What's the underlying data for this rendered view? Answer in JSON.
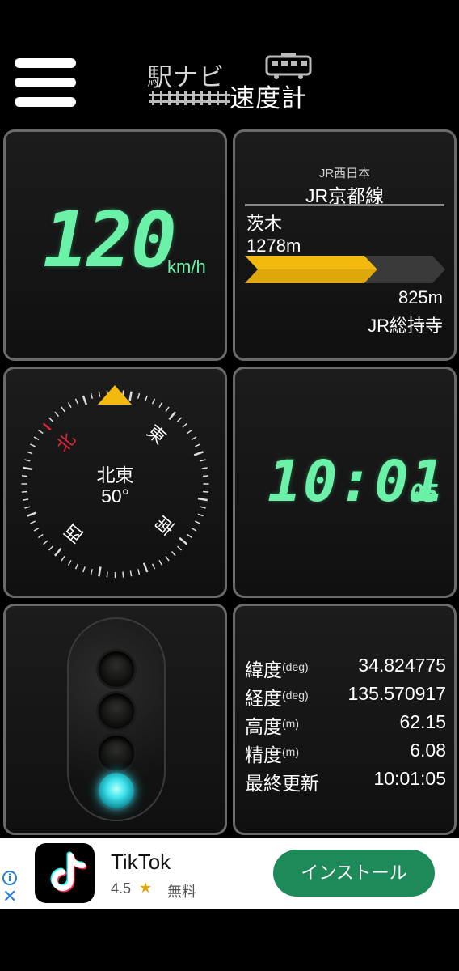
{
  "header": {
    "logo_top": "駅ナビ",
    "logo_bottom": "速度計",
    "menu_icon": "hamburger-menu-icon"
  },
  "speed": {
    "value": "120",
    "unit": "km/h"
  },
  "line": {
    "company": "JR西日本",
    "name": "JR京都線",
    "prev_station": "茨木",
    "prev_distance": "1278m",
    "next_distance": "825m",
    "next_station": "JR総持寺",
    "progress": 0.61,
    "progress_color": "#f2b90f"
  },
  "compass": {
    "direction": "北東",
    "degrees": "50°",
    "heading": 50,
    "labels": {
      "north": "北",
      "east": "東",
      "south": "南",
      "west": "西"
    },
    "north_color": "#e0243a",
    "marker_color": "#f2b90f"
  },
  "clock": {
    "time": "10:01",
    "seconds": "05"
  },
  "signal": {
    "lamps": [
      false,
      false,
      false,
      true
    ],
    "active_color": "#3fe3ec"
  },
  "gps": {
    "rows": [
      {
        "label": "緯度",
        "unit": "(deg)",
        "value": "34.824775"
      },
      {
        "label": "経度",
        "unit": "(deg)",
        "value": "135.570917"
      },
      {
        "label": "高度",
        "unit": "(m)",
        "value": "62.15"
      },
      {
        "label": "精度",
        "unit": "(m)",
        "value": "6.08"
      },
      {
        "label": "最終更新",
        "unit": "",
        "value": "10:01:05"
      }
    ]
  },
  "ad": {
    "title": "TikTok",
    "rating": "4.5",
    "price": "無料",
    "button_label": "インストール",
    "info_label": "i",
    "close_label": "✕"
  },
  "colors": {
    "digit_green": "#6cf2a8",
    "panel_border": "#6a6a6a",
    "install_green": "#1e8a5a"
  }
}
